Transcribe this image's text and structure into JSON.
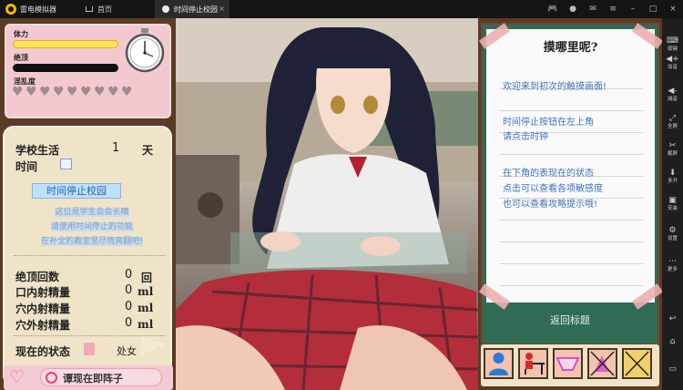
{
  "titlebar": {
    "app_name": "雷电模拟器",
    "tabs": [
      {
        "label": "首页"
      },
      {
        "label": "时间停止校园"
      }
    ],
    "close_glyph": "×"
  },
  "sidebar": {
    "items": [
      {
        "glyph": "⌨",
        "label": "按键"
      },
      {
        "glyph": "◀+",
        "label": "加音"
      },
      {
        "glyph": "◀-",
        "label": "减音"
      },
      {
        "glyph": "⤢",
        "label": "全屏"
      },
      {
        "glyph": "✂",
        "label": "截屏"
      },
      {
        "glyph": "⬇",
        "label": "多开"
      },
      {
        "glyph": "▣",
        "label": "安装"
      },
      {
        "glyph": "⚙",
        "label": "设置"
      },
      {
        "glyph": "⋯",
        "label": "更多"
      },
      {
        "glyph": "↩",
        "label": ""
      },
      {
        "glyph": "⌂",
        "label": ""
      },
      {
        "glyph": "▭",
        "label": ""
      }
    ]
  },
  "stats": {
    "stamina_label": "体力",
    "climax_label": "绝顶",
    "lewdness_label": "淫乱度",
    "heart_glyph": "♥",
    "stamina_level": 1.0,
    "climax_level": 1.0,
    "lewdness_hearts_filled": 0,
    "lewdness_hearts_total": 9
  },
  "school": {
    "life_label": "学校生活",
    "day_value": "1",
    "day_unit": "天",
    "time_label": "时间",
    "stop_button": "时间停止校园",
    "messages": [
      "这位是学生会会长噢",
      "请使用时间停止的功能",
      "在补全的教室里尽情爽翻吧!"
    ],
    "rows": [
      {
        "label": "绝顶回数",
        "value": "0",
        "unit": "回"
      },
      {
        "label": "口内射精量",
        "value": "0",
        "unit": "ml"
      },
      {
        "label": "穴内射精量",
        "value": "0",
        "unit": "ml"
      },
      {
        "label": "穴外射精量",
        "value": "0",
        "unit": "ml"
      }
    ],
    "state_label": "现在的状态",
    "state_value": "处女",
    "status_heart": "♡",
    "status_text": "谭现在即阵子"
  },
  "note": {
    "title": "摸哪里呢?",
    "lines": [
      "欢迎来到初次的触摸画面!",
      "时间停止按钮在左上角",
      "请点击时钟",
      "在下角的表现在的状态",
      "点击可以查看各项敏感度",
      "也可以查看攻略提示哦!"
    ],
    "return_button": "返回标题"
  },
  "tools": [
    {
      "icon": "person-icon",
      "color": "#2b7bd8"
    },
    {
      "icon": "desk-icon",
      "color": "#d82b2b"
    },
    {
      "icon": "panties-icon",
      "color": "#d651c6"
    },
    {
      "icon": "locked-item-icon",
      "color": "#e060c0"
    },
    {
      "icon": "locked-slot-icon",
      "color": "#222222"
    }
  ]
}
